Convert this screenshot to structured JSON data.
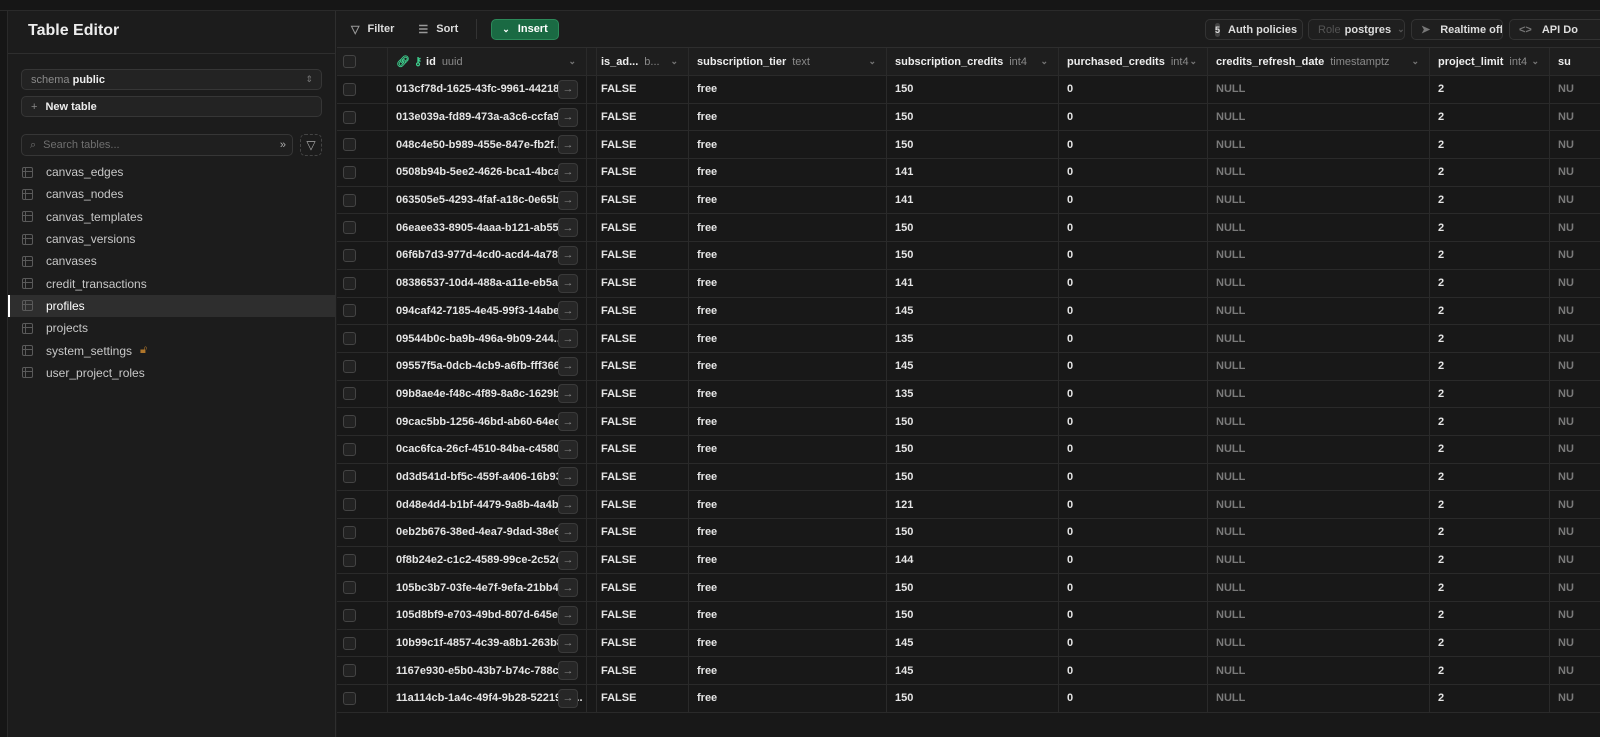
{
  "sidebar": {
    "title": "Table Editor",
    "schema_label": "schema",
    "schema_value": "public",
    "new_table": "New table",
    "search_placeholder": "Search tables...",
    "tables": [
      {
        "name": "canvas_edges"
      },
      {
        "name": "canvas_nodes"
      },
      {
        "name": "canvas_templates"
      },
      {
        "name": "canvas_versions"
      },
      {
        "name": "canvases"
      },
      {
        "name": "credit_transactions"
      },
      {
        "name": "profiles",
        "active": true
      },
      {
        "name": "projects"
      },
      {
        "name": "system_settings",
        "locked": true
      },
      {
        "name": "user_project_roles"
      }
    ]
  },
  "toolbar": {
    "filter": "Filter",
    "sort": "Sort",
    "insert": "Insert",
    "auth_count": "5",
    "auth_policies": "Auth policies",
    "role_label": "Role",
    "role_value": "postgres",
    "realtime": "Realtime off",
    "api_docs": "API Do"
  },
  "colors": {
    "accent": "#3ecf8e",
    "insert_bg": "#1a6a43",
    "lock": "#b0762a"
  },
  "columns": [
    {
      "name": "id",
      "type": "uuid"
    },
    {
      "name": "is_ad...",
      "type": "b..."
    },
    {
      "name": "subscription_tier",
      "type": "text"
    },
    {
      "name": "subscription_credits",
      "type": "int4"
    },
    {
      "name": "purchased_credits",
      "type": "int4"
    },
    {
      "name": "credits_refresh_date",
      "type": "timestamptz"
    },
    {
      "name": "project_limit",
      "type": "int4"
    },
    {
      "name": "su",
      "type": ""
    }
  ],
  "rows": [
    [
      "013cf78d-1625-43fc-9961-442189...",
      "FALSE",
      "free",
      "150",
      "0",
      "NULL",
      "2",
      "NU"
    ],
    [
      "013e039a-fd89-473a-a3c6-ccfa9...",
      "FALSE",
      "free",
      "150",
      "0",
      "NULL",
      "2",
      "NU"
    ],
    [
      "048c4e50-b989-455e-847e-fb2f...",
      "FALSE",
      "free",
      "150",
      "0",
      "NULL",
      "2",
      "NU"
    ],
    [
      "0508b94b-5ee2-4626-bca1-4bca...",
      "FALSE",
      "free",
      "141",
      "0",
      "NULL",
      "2",
      "NU"
    ],
    [
      "063505e5-4293-4faf-a18c-0e65b...",
      "FALSE",
      "free",
      "141",
      "0",
      "NULL",
      "2",
      "NU"
    ],
    [
      "06eaee33-8905-4aaa-b121-ab552...",
      "FALSE",
      "free",
      "150",
      "0",
      "NULL",
      "2",
      "NU"
    ],
    [
      "06f6b7d3-977d-4cd0-acd4-4a78...",
      "FALSE",
      "free",
      "150",
      "0",
      "NULL",
      "2",
      "NU"
    ],
    [
      "08386537-10d4-488a-a11e-eb5a6...",
      "FALSE",
      "free",
      "141",
      "0",
      "NULL",
      "2",
      "NU"
    ],
    [
      "094caf42-7185-4e45-99f3-14abee...",
      "FALSE",
      "free",
      "145",
      "0",
      "NULL",
      "2",
      "NU"
    ],
    [
      "09544b0c-ba9b-496a-9b09-244...",
      "FALSE",
      "free",
      "135",
      "0",
      "NULL",
      "2",
      "NU"
    ],
    [
      "09557f5a-0dcb-4cb9-a6fb-fff366...",
      "FALSE",
      "free",
      "145",
      "0",
      "NULL",
      "2",
      "NU"
    ],
    [
      "09b8ae4e-f48c-4f89-8a8c-1629b...",
      "FALSE",
      "free",
      "135",
      "0",
      "NULL",
      "2",
      "NU"
    ],
    [
      "09cac5bb-1256-46bd-ab60-64ed...",
      "FALSE",
      "free",
      "150",
      "0",
      "NULL",
      "2",
      "NU"
    ],
    [
      "0cac6fca-26cf-4510-84ba-c4580...",
      "FALSE",
      "free",
      "150",
      "0",
      "NULL",
      "2",
      "NU"
    ],
    [
      "0d3d541d-bf5c-459f-a406-16b93...",
      "FALSE",
      "free",
      "150",
      "0",
      "NULL",
      "2",
      "NU"
    ],
    [
      "0d48e4d4-b1bf-4479-9a8b-4a4b...",
      "FALSE",
      "free",
      "121",
      "0",
      "NULL",
      "2",
      "NU"
    ],
    [
      "0eb2b676-38ed-4ea7-9dad-38e6...",
      "FALSE",
      "free",
      "150",
      "0",
      "NULL",
      "2",
      "NU"
    ],
    [
      "0f8b24e2-c1c2-4589-99ce-2c52d...",
      "FALSE",
      "free",
      "144",
      "0",
      "NULL",
      "2",
      "NU"
    ],
    [
      "105bc3b7-03fe-4e7f-9efa-21bb40...",
      "FALSE",
      "free",
      "150",
      "0",
      "NULL",
      "2",
      "NU"
    ],
    [
      "105d8bf9-e703-49bd-807d-645e...",
      "FALSE",
      "free",
      "150",
      "0",
      "NULL",
      "2",
      "NU"
    ],
    [
      "10b99c1f-4857-4c39-a8b1-263b8...",
      "FALSE",
      "free",
      "145",
      "0",
      "NULL",
      "2",
      "NU"
    ],
    [
      "1167e930-e5b0-43b7-b74c-788c9...",
      "FALSE",
      "free",
      "145",
      "0",
      "NULL",
      "2",
      "NU"
    ],
    [
      "11a114cb-1a4c-49f4-9b28-52219ec...",
      "FALSE",
      "free",
      "150",
      "0",
      "NULL",
      "2",
      "NU"
    ]
  ]
}
